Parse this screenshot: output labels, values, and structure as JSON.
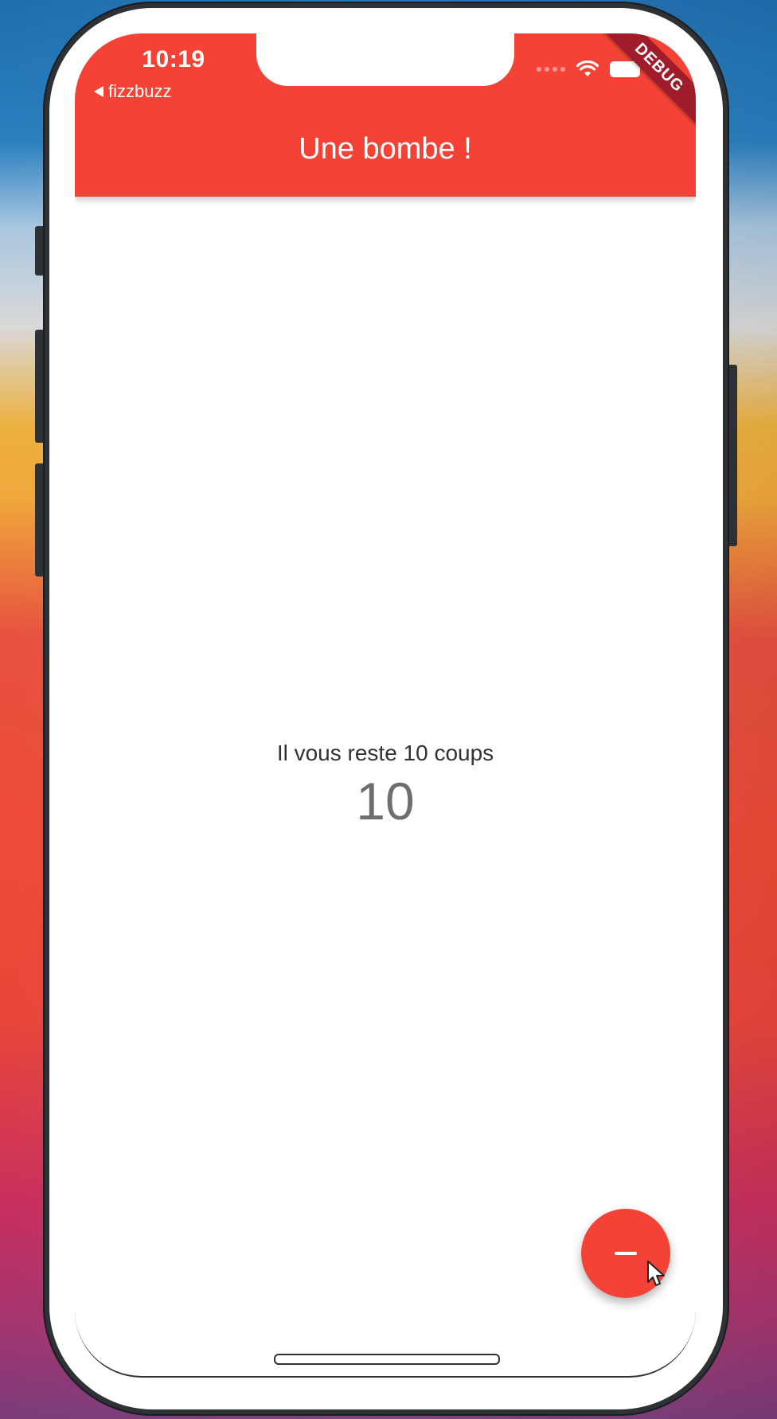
{
  "status_bar": {
    "time": "10:19",
    "back_app": "fizzbuzz"
  },
  "app_bar": {
    "title": "Une bombe !",
    "debug_banner": "DEBUG",
    "color": "#f44336"
  },
  "body": {
    "counter_label": "Il vous reste 10 coups",
    "counter_value": "10"
  },
  "fab": {
    "icon": "minus-icon",
    "color": "#f44336"
  }
}
